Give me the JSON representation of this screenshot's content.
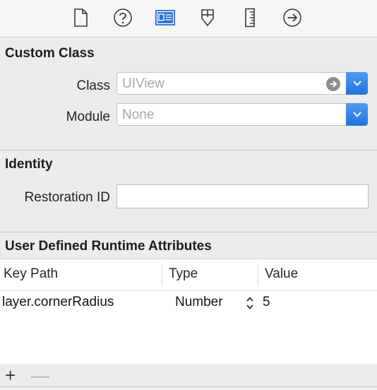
{
  "toolbar": {
    "tabs": [
      {
        "icon": "file-inspector-icon"
      },
      {
        "icon": "quick-help-icon"
      },
      {
        "icon": "identity-inspector-icon",
        "selected": true
      },
      {
        "icon": "attributes-inspector-icon"
      },
      {
        "icon": "size-inspector-icon"
      },
      {
        "icon": "connections-inspector-icon"
      }
    ],
    "selected_color": "#1f6fe0"
  },
  "custom_class": {
    "title": "Custom Class",
    "class_label": "Class",
    "class_placeholder": "UIView",
    "module_label": "Module",
    "module_placeholder": "None"
  },
  "identity": {
    "title": "Identity",
    "restoration_label": "Restoration ID",
    "restoration_value": ""
  },
  "runtime_attributes": {
    "title": "User Defined Runtime Attributes",
    "columns": [
      "Key Path",
      "Type",
      "Value"
    ],
    "rows": [
      {
        "key_path": "layer.cornerRadius",
        "type": "Number",
        "value": "5"
      }
    ],
    "add_label": "+",
    "remove_label": "—"
  }
}
